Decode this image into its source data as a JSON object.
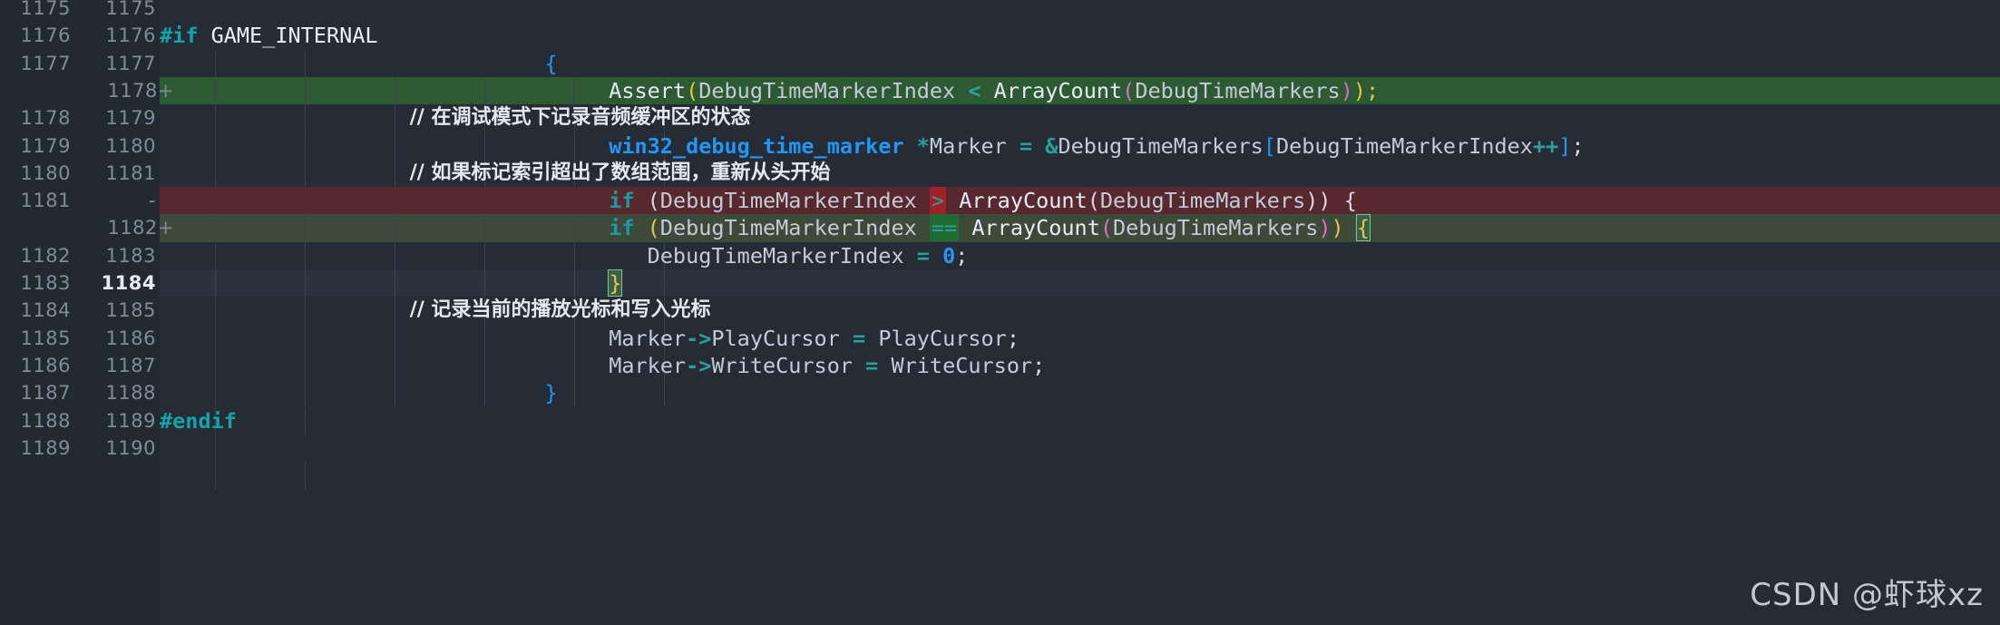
{
  "editor": {
    "kind": "diff-viewer",
    "background": "#262c36",
    "gutter_background": "#232931",
    "row_height": 30.3,
    "added_color": "#2d5a33",
    "added_soft_color": "#3e4a39",
    "deleted_color": "#58282f",
    "cursor_line_color": "#2b323d",
    "word_add_color": "#1f6b33",
    "word_del_color": "#a02028"
  },
  "watermark": {
    "text": "CSDN @虾球xz"
  },
  "rows": [
    {
      "old": "1175",
      "new": "1175",
      "sign": "",
      "state": "context",
      "indent": 0
    },
    {
      "old": "1176",
      "new": "1176",
      "sign": "",
      "state": "context",
      "indent": 0
    },
    {
      "old": "1177",
      "new": "1177",
      "sign": "",
      "state": "context",
      "indent": 2
    },
    {
      "old": "",
      "new": "1178",
      "sign": "+",
      "state": "added",
      "indent": 6
    },
    {
      "old": "1178",
      "new": "1179",
      "sign": "",
      "state": "context",
      "indent": 6
    },
    {
      "old": "1179",
      "new": "1180",
      "sign": "",
      "state": "context",
      "indent": 6
    },
    {
      "old": "1180",
      "new": "1181",
      "sign": "",
      "state": "context",
      "indent": 6
    },
    {
      "old": "1181",
      "new": "",
      "sign": "-",
      "state": "deleted",
      "indent": 0
    },
    {
      "old": "",
      "new": "1182",
      "sign": "+",
      "state": "added-soft",
      "indent": 6
    },
    {
      "old": "1182",
      "new": "1183",
      "sign": "",
      "state": "context",
      "indent": 6
    },
    {
      "old": "1183",
      "new": "1184",
      "sign": "",
      "state": "cursor",
      "indent": 6
    },
    {
      "old": "1184",
      "new": "1185",
      "sign": "",
      "state": "context",
      "indent": 6
    },
    {
      "old": "1185",
      "new": "1186",
      "sign": "",
      "state": "context",
      "indent": 6
    },
    {
      "old": "1186",
      "new": "1187",
      "sign": "",
      "state": "context",
      "indent": 6
    },
    {
      "old": "1187",
      "new": "1188",
      "sign": "",
      "state": "context",
      "indent": 2
    },
    {
      "old": "1188",
      "new": "1189",
      "sign": "",
      "state": "context",
      "indent": 0
    },
    {
      "old": "1189",
      "new": "1190",
      "sign": "",
      "state": "context",
      "indent": 0
    }
  ],
  "code_lines": {
    "l1175": "",
    "l1176": "#if GAME_INTERNAL",
    "l1177": "{",
    "l1178_add": "Assert(DebugTimeMarkerIndex < ArrayCount(DebugTimeMarkers));",
    "l1179": "// 在调试模式下记录音频缓冲区的状态",
    "l1180": "win32_debug_time_marker *Marker = &DebugTimeMarkers[DebugTimeMarkerIndex++];",
    "l1181": "// 如果标记索引超出了数组范围，重新从头开始",
    "l1181_del": "if (DebugTimeMarkerIndex > ArrayCount(DebugTimeMarkers)) {",
    "l1182_add": "if (DebugTimeMarkerIndex == ArrayCount(DebugTimeMarkers)) {",
    "l1183": "DebugTimeMarkerIndex = 0;",
    "l1184": "}",
    "l1185": "// 记录当前的播放光标和写入光标",
    "l1186": "Marker->PlayCursor = PlayCursor;",
    "l1187": "Marker->WriteCursor = WriteCursor;",
    "l1188": "}",
    "l1189": "#endif"
  },
  "tokens": {
    "preproc_if": "#if",
    "preproc_endif": "#endif",
    "macro_name": "GAME_INTERNAL",
    "keyword_if": "if",
    "fn_assert": "Assert",
    "fn_arraycount": "ArrayCount",
    "var_index": "DebugTimeMarkerIndex",
    "var_markers": "DebugTimeMarkers",
    "type_marker": "win32_debug_time_marker",
    "var_marker": "Marker",
    "field_play": "PlayCursor",
    "field_write": "WriteCursor",
    "op_lt": "<",
    "op_gt": ">",
    "op_eq": "==",
    "op_assign": "=",
    "num_zero": "0"
  }
}
